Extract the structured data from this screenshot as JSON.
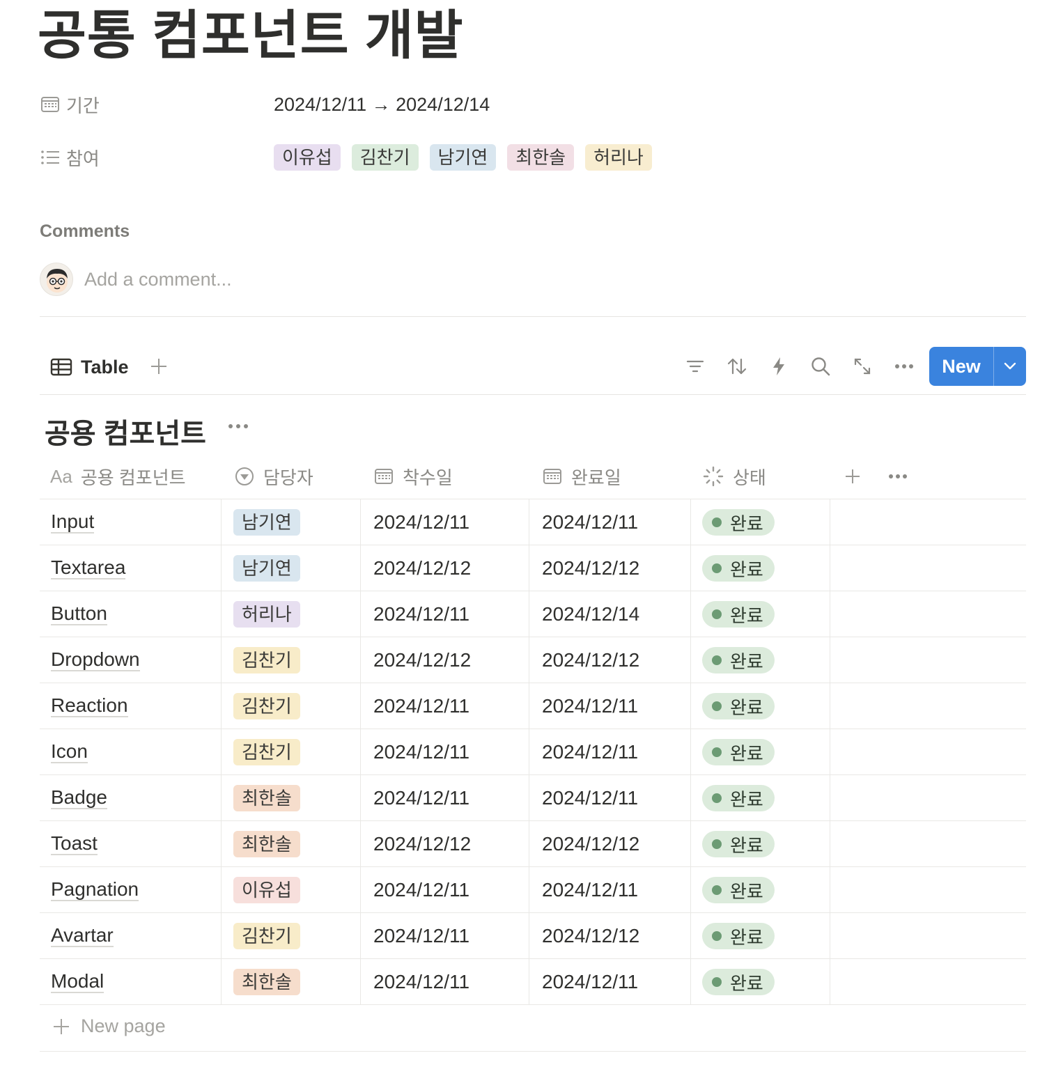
{
  "page": {
    "title": "공통 컴포넌트 개발"
  },
  "properties": {
    "period_label": "기간",
    "period_value": "2024/12/11 → 2024/12/14",
    "participants_label": "참여",
    "participants": [
      {
        "name": "이유섭",
        "color": "#e8def0"
      },
      {
        "name": "김찬기",
        "color": "#dcecdd"
      },
      {
        "name": "남기연",
        "color": "#d9e6ef"
      },
      {
        "name": "최한솔",
        "color": "#f2dfe5"
      },
      {
        "name": "허리나",
        "color": "#f8edd0"
      }
    ]
  },
  "comments": {
    "heading": "Comments",
    "placeholder": "Add a comment..."
  },
  "toolbar": {
    "view_label": "Table",
    "new_label": "New"
  },
  "database": {
    "title": "공용 컴포넌트",
    "columns": {
      "name": "공용 컴포넌트",
      "assignee": "담당자",
      "start": "착수일",
      "end": "완료일",
      "status": "상태"
    },
    "rows": [
      {
        "name": "Input",
        "assignee": "남기연",
        "assignee_color": "#d9e6ef",
        "start": "2024/12/11",
        "end": "2024/12/11",
        "status": "완료"
      },
      {
        "name": "Textarea",
        "assignee": "남기연",
        "assignee_color": "#d9e6ef",
        "start": "2024/12/12",
        "end": "2024/12/12",
        "status": "완료"
      },
      {
        "name": "Button",
        "assignee": "허리나",
        "assignee_color": "#e7dff0",
        "start": "2024/12/11",
        "end": "2024/12/14",
        "status": "완료"
      },
      {
        "name": "Dropdown",
        "assignee": "김찬기",
        "assignee_color": "#f8ecc9",
        "start": "2024/12/12",
        "end": "2024/12/12",
        "status": "완료"
      },
      {
        "name": "Reaction",
        "assignee": "김찬기",
        "assignee_color": "#f8ecc9",
        "start": "2024/12/11",
        "end": "2024/12/11",
        "status": "완료"
      },
      {
        "name": "Icon",
        "assignee": "김찬기",
        "assignee_color": "#f8ecc9",
        "start": "2024/12/11",
        "end": "2024/12/11",
        "status": "완료"
      },
      {
        "name": "Badge",
        "assignee": "최한솔",
        "assignee_color": "#f6ddcc",
        "start": "2024/12/11",
        "end": "2024/12/11",
        "status": "완료"
      },
      {
        "name": "Toast",
        "assignee": "최한솔",
        "assignee_color": "#f6ddcc",
        "start": "2024/12/12",
        "end": "2024/12/12",
        "status": "완료"
      },
      {
        "name": "Pagnation",
        "assignee": "이유섭",
        "assignee_color": "#f7dfdc",
        "start": "2024/12/11",
        "end": "2024/12/11",
        "status": "완료"
      },
      {
        "name": "Avartar",
        "assignee": "김찬기",
        "assignee_color": "#f8ecc9",
        "start": "2024/12/11",
        "end": "2024/12/12",
        "status": "완료"
      },
      {
        "name": "Modal",
        "assignee": "최한솔",
        "assignee_color": "#f6ddcc",
        "start": "2024/12/11",
        "end": "2024/12/11",
        "status": "완료"
      }
    ],
    "new_page_label": "New page"
  },
  "colors": {
    "accent": "#3a83de",
    "status_bg": "#dcebdc",
    "status_dot": "#6c9b74"
  }
}
